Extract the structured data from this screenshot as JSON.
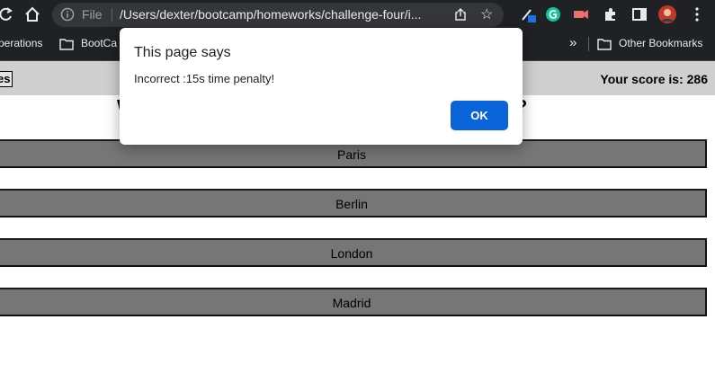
{
  "browser": {
    "file_label": "File",
    "url": "/Users/dexter/bootcamp/homeworks/challenge-four/i..."
  },
  "bookmarks": {
    "items": [
      "perations",
      "BootCa"
    ],
    "overflow": "»",
    "other": "Other Bookmarks"
  },
  "page": {
    "highscores_label": "es",
    "score_text": "Your score is: 286",
    "question_visible": "W",
    "question_end": "?",
    "answers": [
      "Paris",
      "Berlin",
      "London",
      "Madrid"
    ]
  },
  "dialog": {
    "title": "This page says",
    "message": "Incorrect :15s time penalty!",
    "ok_label": "OK",
    "accent": "#0b63d9"
  },
  "icons": [
    "reload-icon",
    "home-icon",
    "info-icon",
    "share-icon",
    "star-icon",
    "pen-extension-icon",
    "grammarly-icon",
    "screen-record-icon",
    "puzzle-extension-icon",
    "sidebar-icon",
    "profile-avatar",
    "kebab-menu-icon",
    "folder-icon"
  ]
}
